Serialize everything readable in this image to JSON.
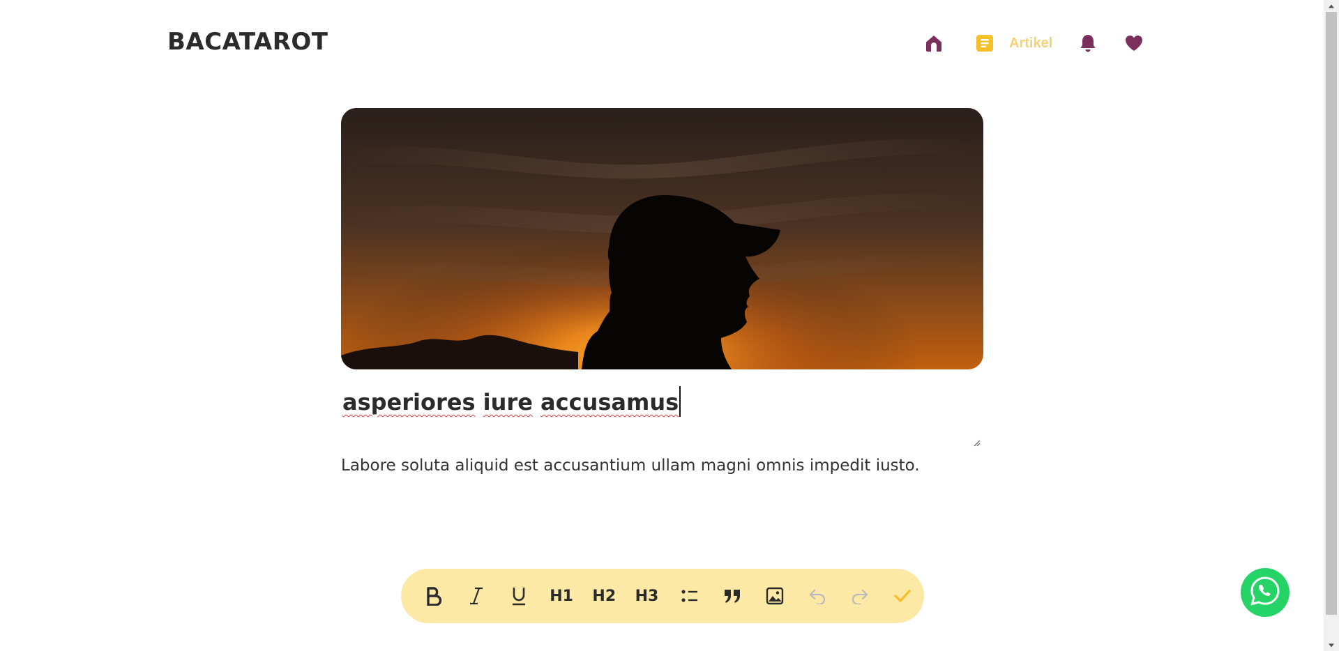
{
  "header": {
    "logo": "BACATAROT",
    "nav": {
      "home_icon": "home-icon",
      "article_icon": "article-icon",
      "article_label": "Artikel",
      "bell_icon": "bell-icon",
      "heart_icon": "heart-icon",
      "active_color": "#f5c02c",
      "icon_color": "#7b2f5c"
    }
  },
  "article": {
    "cover_image": "silhouette-sunset-image",
    "title_words": [
      "asperiores",
      "iure",
      "accusamus"
    ],
    "body": "Labore soluta aliquid est accusantium ullam magni omnis impedit iusto."
  },
  "toolbar": {
    "background": "#fde9a6",
    "buttons": [
      {
        "name": "bold",
        "icon": "bold-icon"
      },
      {
        "name": "italic",
        "icon": "italic-icon"
      },
      {
        "name": "underline",
        "icon": "underline-icon"
      },
      {
        "name": "h1",
        "label": "H1"
      },
      {
        "name": "h2",
        "label": "H2"
      },
      {
        "name": "h3",
        "label": "H3"
      },
      {
        "name": "bullet-list",
        "icon": "list-icon"
      },
      {
        "name": "quote",
        "icon": "quote-icon"
      },
      {
        "name": "image",
        "icon": "image-icon"
      },
      {
        "name": "undo",
        "icon": "undo-icon",
        "disabled": true
      },
      {
        "name": "redo",
        "icon": "redo-icon",
        "disabled": true
      },
      {
        "name": "save",
        "icon": "check-icon"
      }
    ]
  },
  "whatsapp": {
    "icon": "whatsapp-icon",
    "color": "#25d366"
  }
}
